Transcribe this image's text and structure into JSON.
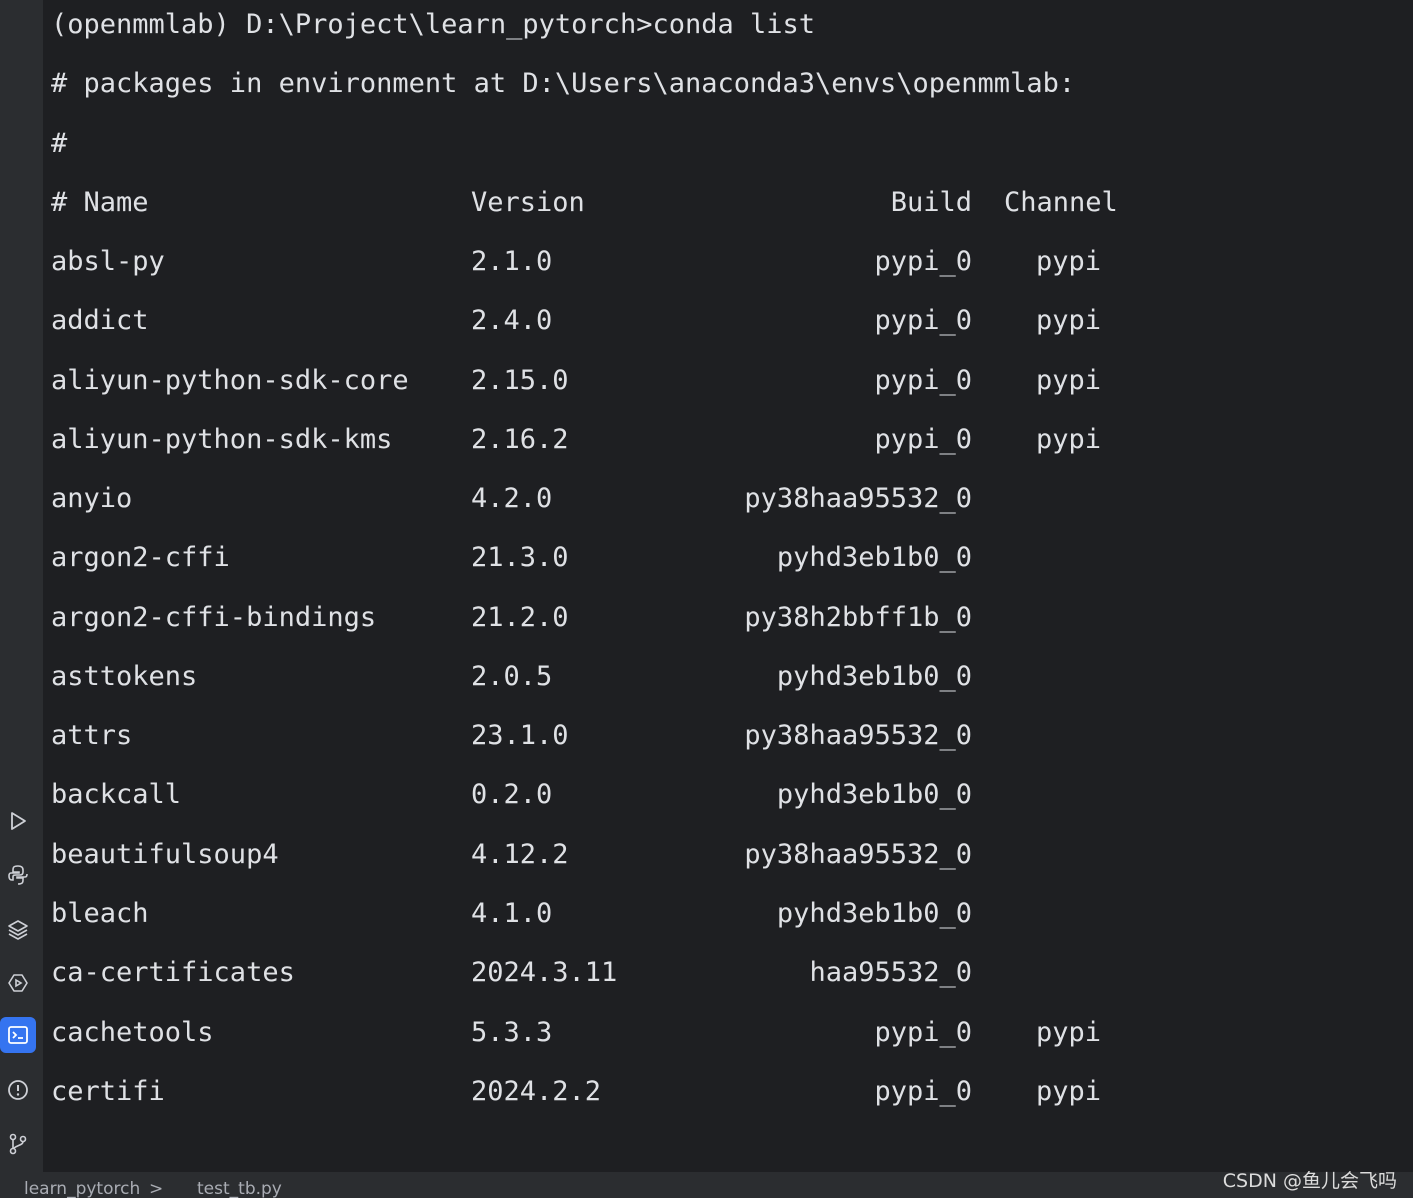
{
  "terminal": {
    "prompt": "(openmmlab) D:\\Project\\learn_pytorch>conda list",
    "env_line": "# packages in environment at D:\\Users\\anaconda3\\envs\\openmmlab:",
    "hash_line": "#",
    "headers": {
      "name": "# Name",
      "version": "Version",
      "build": "Build",
      "channel": "Channel"
    },
    "rows": [
      {
        "name": "absl-py",
        "version": "2.1.0",
        "build": "pypi_0",
        "channel": "pypi"
      },
      {
        "name": "addict",
        "version": "2.4.0",
        "build": "pypi_0",
        "channel": "pypi"
      },
      {
        "name": "aliyun-python-sdk-core",
        "version": "2.15.0",
        "build": "pypi_0",
        "channel": "pypi"
      },
      {
        "name": "aliyun-python-sdk-kms",
        "version": "2.16.2",
        "build": "pypi_0",
        "channel": "pypi"
      },
      {
        "name": "anyio",
        "version": "4.2.0",
        "build": "py38haa95532_0",
        "channel": ""
      },
      {
        "name": "argon2-cffi",
        "version": "21.3.0",
        "build": "pyhd3eb1b0_0",
        "channel": ""
      },
      {
        "name": "argon2-cffi-bindings",
        "version": "21.2.0",
        "build": "py38h2bbff1b_0",
        "channel": ""
      },
      {
        "name": "asttokens",
        "version": "2.0.5",
        "build": "pyhd3eb1b0_0",
        "channel": ""
      },
      {
        "name": "attrs",
        "version": "23.1.0",
        "build": "py38haa95532_0",
        "channel": ""
      },
      {
        "name": "backcall",
        "version": "0.2.0",
        "build": "pyhd3eb1b0_0",
        "channel": ""
      },
      {
        "name": "beautifulsoup4",
        "version": "4.12.2",
        "build": "py38haa95532_0",
        "channel": ""
      },
      {
        "name": "bleach",
        "version": "4.1.0",
        "build": "pyhd3eb1b0_0",
        "channel": ""
      },
      {
        "name": "ca-certificates",
        "version": "2024.3.11",
        "build": "haa95532_0",
        "channel": ""
      },
      {
        "name": "cachetools",
        "version": "5.3.3",
        "build": "pypi_0",
        "channel": "pypi"
      },
      {
        "name": "certifi",
        "version": "2024.2.2",
        "build": "pypi_0",
        "channel": "pypi"
      }
    ]
  },
  "sidebar": {
    "tools": [
      {
        "icon": "run-icon"
      },
      {
        "icon": "python-console-icon"
      },
      {
        "icon": "layers-icon"
      },
      {
        "icon": "services-icon"
      },
      {
        "icon": "terminal-icon",
        "active": true
      },
      {
        "icon": "problems-icon"
      },
      {
        "icon": "git-branch-icon"
      }
    ]
  },
  "statusbar": {
    "project": "learn_pytorch",
    "separator": ">",
    "file": "test_tb.py"
  },
  "watermark": "CSDN @鱼儿会飞吗",
  "colors": {
    "background": "#1e1f22",
    "sidebar": "#2b2d30",
    "text": "#dfe1e5",
    "active_tool": "#3574f0"
  }
}
